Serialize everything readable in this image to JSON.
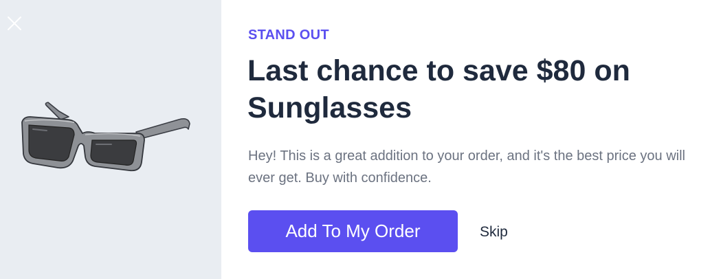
{
  "offer": {
    "eyebrow": "STAND OUT",
    "headline": "Last chance to save $80 on Sunglasses",
    "description": "Hey! This is a great addition to your order, and it's the best price you will ever get. Buy with confidence.",
    "primary_button_label": "Add To My Order",
    "skip_label": "Skip"
  },
  "icons": {
    "close": "close-icon",
    "product": "sunglasses-image"
  },
  "colors": {
    "accent": "#5b4ff0",
    "heading": "#1f2a3d",
    "body_text": "#6b7280",
    "image_panel_bg": "#e9edf2"
  }
}
